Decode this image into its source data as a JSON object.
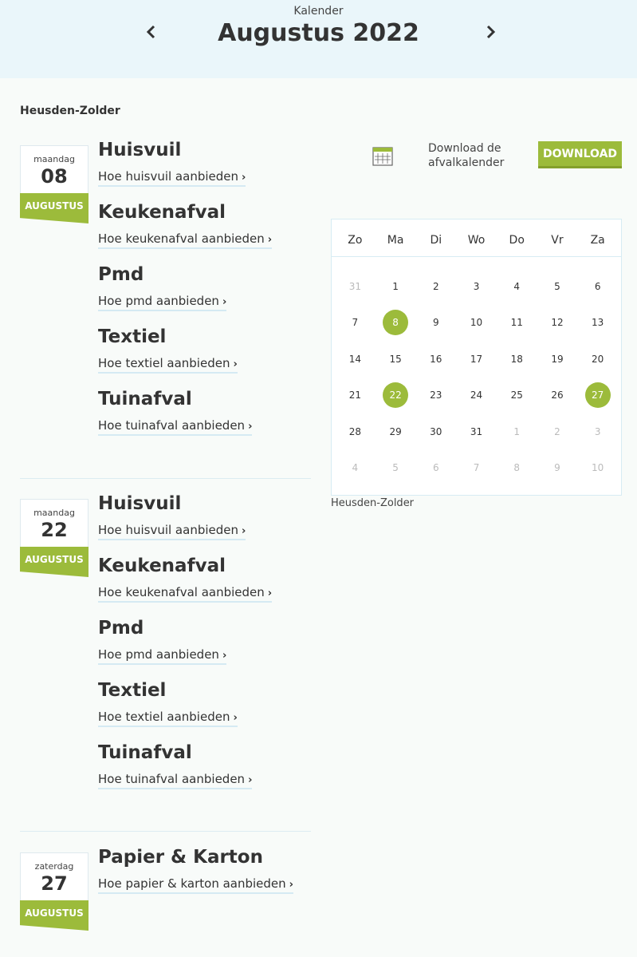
{
  "header": {
    "subtitle": "Kalender",
    "title": "Augustus 2022"
  },
  "location": "Heusden-Zolder",
  "download": {
    "text_line1": "Download de",
    "text_line2": "afvalkalender",
    "button": "DOWNLOAD"
  },
  "calendar": {
    "weekdays": [
      "Zo",
      "Ma",
      "Di",
      "Wo",
      "Do",
      "Vr",
      "Za"
    ],
    "weeks": [
      [
        "31",
        "1",
        "2",
        "3",
        "4",
        "5",
        "6"
      ],
      [
        "7",
        "8",
        "9",
        "10",
        "11",
        "12",
        "13"
      ],
      [
        "14",
        "15",
        "16",
        "17",
        "18",
        "19",
        "20"
      ],
      [
        "21",
        "22",
        "23",
        "24",
        "25",
        "26",
        "27"
      ],
      [
        "28",
        "29",
        "30",
        "31",
        "1",
        "2",
        "3"
      ],
      [
        "4",
        "5",
        "6",
        "7",
        "8",
        "9",
        "10"
      ]
    ],
    "muted": [
      [
        0,
        0
      ],
      [
        4,
        4
      ],
      [
        4,
        5
      ],
      [
        4,
        6
      ],
      [
        5,
        0
      ],
      [
        5,
        1
      ],
      [
        5,
        2
      ],
      [
        5,
        3
      ],
      [
        5,
        4
      ],
      [
        5,
        5
      ],
      [
        5,
        6
      ]
    ],
    "highlighted": [
      [
        1,
        1
      ],
      [
        3,
        1
      ],
      [
        3,
        6
      ]
    ],
    "location": "Heusden-Zolder"
  },
  "entries": [
    {
      "weekday": "maandag",
      "day": "08",
      "month": "AUGUSTUS",
      "types": [
        {
          "name": "Huisvuil",
          "link": "Hoe huisvuil aanbieden"
        },
        {
          "name": "Keukenafval",
          "link": "Hoe keukenafval aanbieden"
        },
        {
          "name": "Pmd",
          "link": "Hoe pmd aanbieden"
        },
        {
          "name": "Textiel",
          "link": "Hoe textiel aanbieden"
        },
        {
          "name": "Tuinafval",
          "link": "Hoe tuinafval aanbieden"
        }
      ]
    },
    {
      "weekday": "maandag",
      "day": "22",
      "month": "AUGUSTUS",
      "types": [
        {
          "name": "Huisvuil",
          "link": "Hoe huisvuil aanbieden"
        },
        {
          "name": "Keukenafval",
          "link": "Hoe keukenafval aanbieden"
        },
        {
          "name": "Pmd",
          "link": "Hoe pmd aanbieden"
        },
        {
          "name": "Textiel",
          "link": "Hoe textiel aanbieden"
        },
        {
          "name": "Tuinafval",
          "link": "Hoe tuinafval aanbieden"
        }
      ]
    },
    {
      "weekday": "zaterdag",
      "day": "27",
      "month": "AUGUSTUS",
      "types": [
        {
          "name": "Papier & Karton",
          "link": "Hoe papier & karton aanbieden"
        }
      ]
    }
  ]
}
